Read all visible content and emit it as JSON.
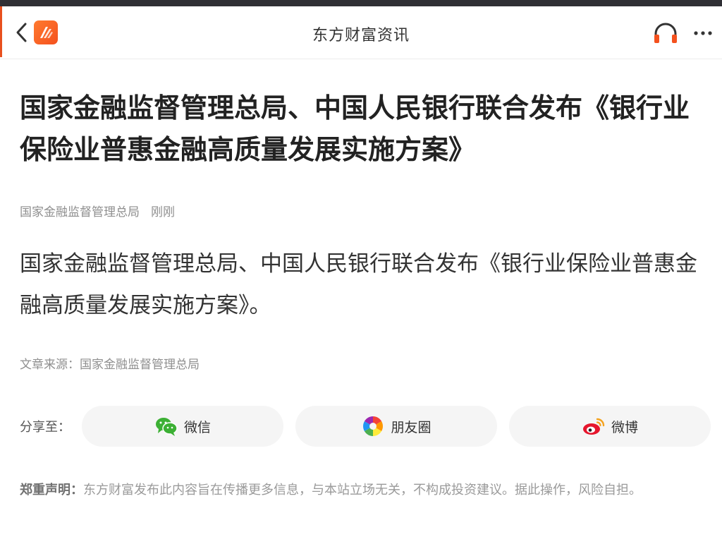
{
  "nav": {
    "title": "东方财富资讯",
    "back_icon": "chevron-left-icon",
    "logo_icon": "eastmoney-logo-icon",
    "audio_icon": "headphones-icon",
    "more_icon": "more-dots-icon"
  },
  "colors": {
    "accent": "#e8501e",
    "audio_orange": "#f4511e",
    "wechat_green": "#3cb034",
    "weibo_red": "#e6162d"
  },
  "article": {
    "title": "国家金融监督管理总局、中国人民银行联合发布《银行业保险业普惠金融高质量发展实施方案》",
    "author": "国家金融监督管理总局",
    "time": "刚刚",
    "body": "国家金融监督管理总局、中国人民银行联合发布《银行业保险业普惠金融高质量发展实施方案》。",
    "source_label": "文章来源：",
    "source_value": "国家金融监督管理总局"
  },
  "share": {
    "label": "分享至：",
    "options": [
      {
        "label": "微信",
        "icon": "wechat-icon"
      },
      {
        "label": "朋友圈",
        "icon": "moments-icon"
      },
      {
        "label": "微博",
        "icon": "weibo-icon"
      }
    ]
  },
  "disclaimer": {
    "label": "郑重声明：",
    "text": "东方财富发布此内容旨在传播更多信息，与本站立场无关，不构成投资建议。据此操作，风险自担。"
  }
}
